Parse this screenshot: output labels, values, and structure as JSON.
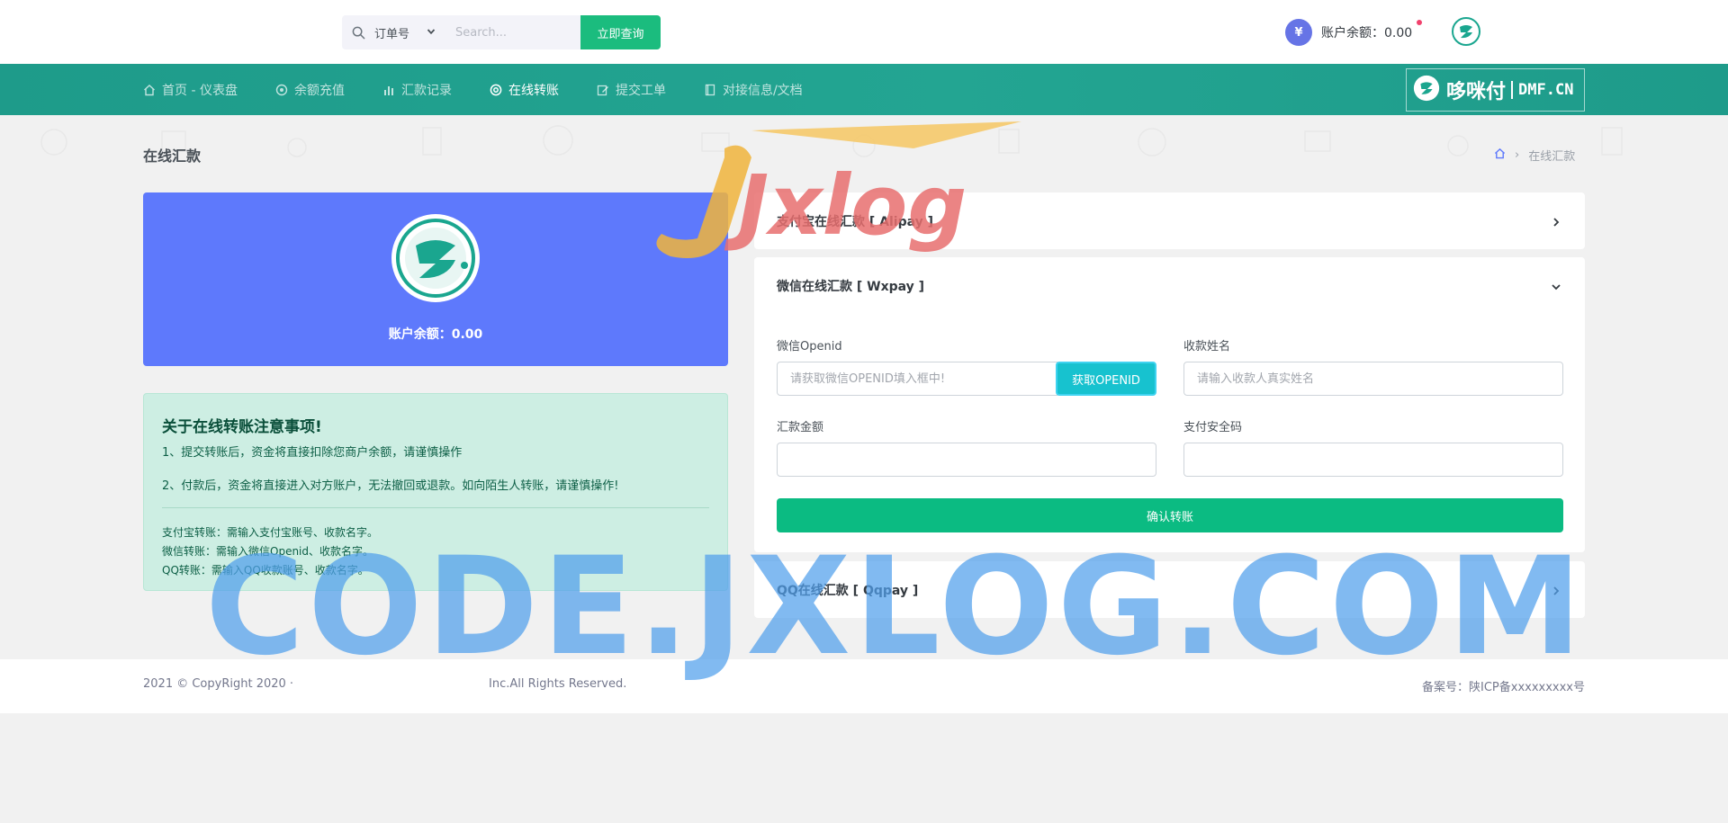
{
  "search": {
    "type_label": "订单号",
    "placeholder": "Search...",
    "button_label": "立即查询"
  },
  "topbar": {
    "currency_symbol": "¥",
    "balance_label": "账户余额：0.00"
  },
  "nav": {
    "items": [
      {
        "label": "首页 - 仪表盘",
        "icon": "home-icon"
      },
      {
        "label": "余额充值",
        "icon": "target-icon"
      },
      {
        "label": "汇款记录",
        "icon": "bar-chart-icon"
      },
      {
        "label": "在线转账",
        "icon": "life-ring-icon"
      },
      {
        "label": "提交工单",
        "icon": "edit-icon"
      },
      {
        "label": "对接信息/文档",
        "icon": "book-icon"
      }
    ],
    "active_index": 3,
    "brand_cn": "哆咪付",
    "brand_en": "DMF.CN"
  },
  "page": {
    "title": "在线汇款",
    "breadcrumb_current": "在线汇款"
  },
  "profile": {
    "balance_label": "账户余额：0.00"
  },
  "notice": {
    "title": "关于在线转账注意事项!",
    "lines": [
      "1、提交转账后，资金将直接扣除您商户余额，请谨慎操作",
      "2、付款后，资金将直接进入对方账户，无法撤回或退款。如向陌生人转账，请谨慎操作!"
    ],
    "tips": [
      "支付宝转账：需输入支付宝账号、收款名字。",
      "微信转账：需输入微信Openid、收款名字。",
      "QQ转账：需输入QQ收款账号、收款名字。"
    ]
  },
  "accordion": {
    "alipay_title": "支付宝在线汇款 [ Alipay ]",
    "wxpay_title": "微信在线汇款 [ Wxpay ]",
    "qqpay_title": "QQ在线汇款 [ Qqpay ]"
  },
  "form": {
    "openid_label": "微信Openid",
    "openid_placeholder": "请获取微信OPENID填入框中!",
    "openid_button": "获取OPENID",
    "name_label": "收款姓名",
    "name_placeholder": "请输入收款人真实姓名",
    "amount_label": "汇款金额",
    "amount_value": "",
    "code_label": "支付安全码",
    "code_value": "",
    "submit_label": "确认转账"
  },
  "footer": {
    "copyright": "2021 © CopyRight 2020 · ",
    "rights": "Inc.All Rights Reserved.",
    "icp": "备案号：陕ICP备xxxxxxxxx号"
  },
  "watermark": {
    "top_text": "Jxlog",
    "bottom_text": "CODE.JXLOG.COM"
  },
  "colors": {
    "nav_bg": "#23a592",
    "profile_bg": "#5e79fc",
    "notice_bg": "#cdeee3",
    "primary_green": "#0bbb82",
    "openid_btn": "#17c2cf"
  }
}
